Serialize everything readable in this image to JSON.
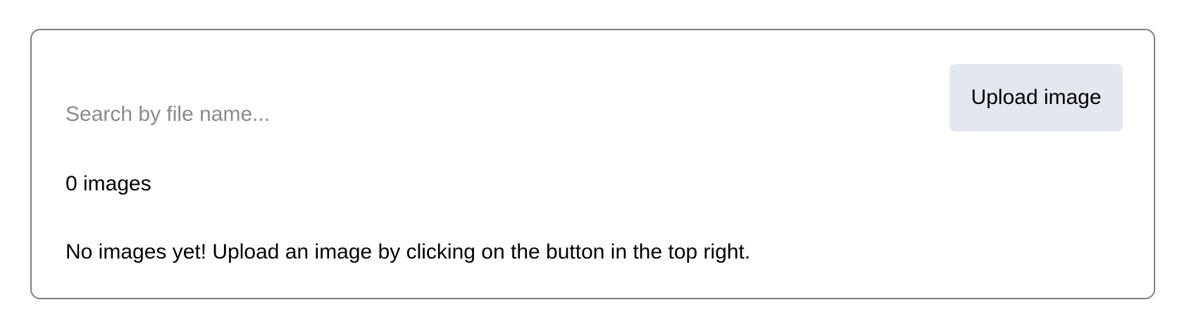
{
  "gallery": {
    "search": {
      "placeholder": "Search by file name...",
      "value": ""
    },
    "upload_button_label": "Upload image",
    "count_label": "0 images",
    "empty_message": "No images yet! Upload an image by clicking on the button in the top right."
  },
  "colors": {
    "panel_border": "#7f7f7f",
    "button_background": "#e3e7ef",
    "placeholder_text": "#8a8a8a"
  }
}
